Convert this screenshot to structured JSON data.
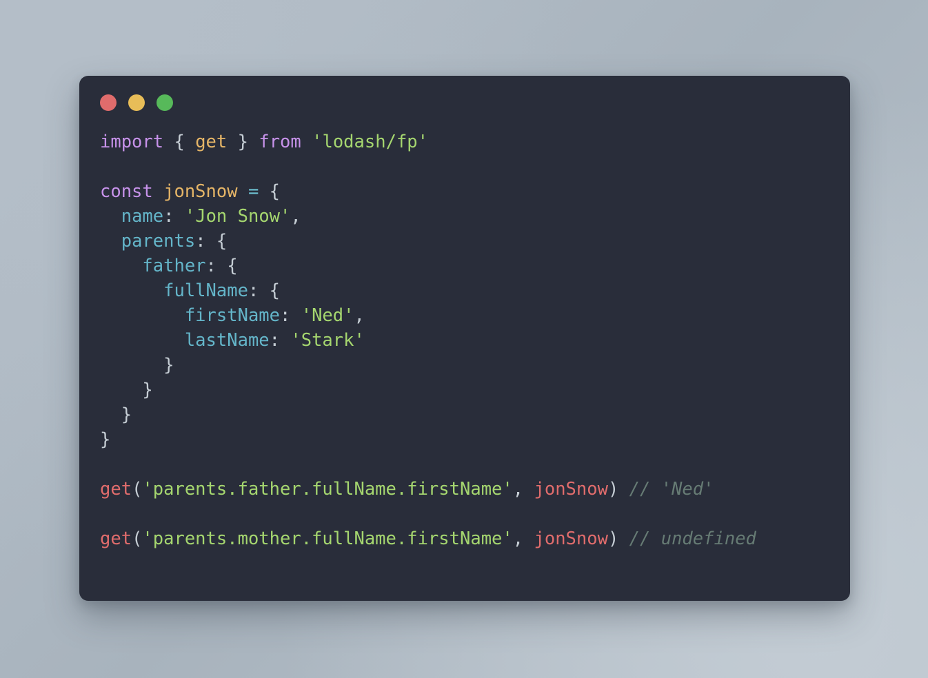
{
  "window": {
    "traffic_lights": [
      {
        "name": "close-button",
        "color": "#e06c6c"
      },
      {
        "name": "minimize-button",
        "color": "#e8bd58"
      },
      {
        "name": "maximize-button",
        "color": "#57b95a"
      }
    ],
    "background_color": "#292d3a",
    "page_background_color": "#aeb8c2"
  },
  "theme": {
    "keyword": "#c792ea",
    "identifier": "#e5b567",
    "string": "#a5d66f",
    "property": "#64b5c9",
    "operator": "#6fc3d4",
    "punctuation": "#c5cdd4",
    "function": "#e06c6c",
    "comment": "#667b74"
  },
  "code": {
    "language": "javascript",
    "raw": "import { get } from 'lodash/fp'\n\nconst jonSnow = {\n  name: 'Jon Snow',\n  parents: {\n    father: {\n      fullName: {\n        firstName: 'Ned',\n        lastName: 'Stark'\n      }\n    }\n  }\n}\n\nget('parents.father.fullName.firstName', jonSnow) // 'Ned'\n\nget('parents.mother.fullName.firstName', jonSnow) // undefined",
    "lines": [
      {
        "n": 1,
        "tokens": [
          {
            "t": "import",
            "c": "kw"
          },
          {
            "t": " ",
            "c": "punc"
          },
          {
            "t": "{",
            "c": "punc"
          },
          {
            "t": " ",
            "c": "punc"
          },
          {
            "t": "get",
            "c": "ident"
          },
          {
            "t": " ",
            "c": "punc"
          },
          {
            "t": "}",
            "c": "punc"
          },
          {
            "t": " ",
            "c": "punc"
          },
          {
            "t": "from",
            "c": "kw"
          },
          {
            "t": " ",
            "c": "punc"
          },
          {
            "t": "'lodash/fp'",
            "c": "str"
          }
        ]
      },
      {
        "n": 2,
        "tokens": []
      },
      {
        "n": 3,
        "tokens": [
          {
            "t": "const",
            "c": "kw"
          },
          {
            "t": " ",
            "c": "punc"
          },
          {
            "t": "jonSnow",
            "c": "ident"
          },
          {
            "t": " ",
            "c": "punc"
          },
          {
            "t": "=",
            "c": "op"
          },
          {
            "t": " ",
            "c": "punc"
          },
          {
            "t": "{",
            "c": "punc"
          }
        ]
      },
      {
        "n": 4,
        "tokens": [
          {
            "t": "  ",
            "c": "punc"
          },
          {
            "t": "name",
            "c": "prop"
          },
          {
            "t": ": ",
            "c": "punc"
          },
          {
            "t": "'Jon Snow'",
            "c": "str"
          },
          {
            "t": ",",
            "c": "punc"
          }
        ]
      },
      {
        "n": 5,
        "tokens": [
          {
            "t": "  ",
            "c": "punc"
          },
          {
            "t": "parents",
            "c": "prop"
          },
          {
            "t": ": ",
            "c": "punc"
          },
          {
            "t": "{",
            "c": "punc"
          }
        ]
      },
      {
        "n": 6,
        "tokens": [
          {
            "t": "    ",
            "c": "punc"
          },
          {
            "t": "father",
            "c": "prop"
          },
          {
            "t": ": ",
            "c": "punc"
          },
          {
            "t": "{",
            "c": "punc"
          }
        ]
      },
      {
        "n": 7,
        "tokens": [
          {
            "t": "      ",
            "c": "punc"
          },
          {
            "t": "fullName",
            "c": "prop"
          },
          {
            "t": ": ",
            "c": "punc"
          },
          {
            "t": "{",
            "c": "punc"
          }
        ]
      },
      {
        "n": 8,
        "tokens": [
          {
            "t": "        ",
            "c": "punc"
          },
          {
            "t": "firstName",
            "c": "prop"
          },
          {
            "t": ": ",
            "c": "punc"
          },
          {
            "t": "'Ned'",
            "c": "str"
          },
          {
            "t": ",",
            "c": "punc"
          }
        ]
      },
      {
        "n": 9,
        "tokens": [
          {
            "t": "        ",
            "c": "punc"
          },
          {
            "t": "lastName",
            "c": "prop"
          },
          {
            "t": ": ",
            "c": "punc"
          },
          {
            "t": "'Stark'",
            "c": "str"
          }
        ]
      },
      {
        "n": 10,
        "tokens": [
          {
            "t": "      }",
            "c": "punc"
          }
        ]
      },
      {
        "n": 11,
        "tokens": [
          {
            "t": "    }",
            "c": "punc"
          }
        ]
      },
      {
        "n": 12,
        "tokens": [
          {
            "t": "  }",
            "c": "punc"
          }
        ]
      },
      {
        "n": 13,
        "tokens": [
          {
            "t": "}",
            "c": "punc"
          }
        ]
      },
      {
        "n": 14,
        "tokens": []
      },
      {
        "n": 15,
        "tokens": [
          {
            "t": "get",
            "c": "fn"
          },
          {
            "t": "(",
            "c": "punc"
          },
          {
            "t": "'parents.father.fullName.firstName'",
            "c": "str"
          },
          {
            "t": ", ",
            "c": "punc"
          },
          {
            "t": "jonSnow",
            "c": "arg"
          },
          {
            "t": ")",
            "c": "punc"
          },
          {
            "t": " ",
            "c": "punc"
          },
          {
            "t": "// 'Ned'",
            "c": "cmt"
          }
        ]
      },
      {
        "n": 16,
        "tokens": []
      },
      {
        "n": 17,
        "tokens": [
          {
            "t": "get",
            "c": "fn"
          },
          {
            "t": "(",
            "c": "punc"
          },
          {
            "t": "'parents.mother.fullName.firstName'",
            "c": "str"
          },
          {
            "t": ", ",
            "c": "punc"
          },
          {
            "t": "jonSnow",
            "c": "arg"
          },
          {
            "t": ")",
            "c": "punc"
          },
          {
            "t": " ",
            "c": "punc"
          },
          {
            "t": "// undefined",
            "c": "cmt"
          }
        ]
      }
    ]
  }
}
